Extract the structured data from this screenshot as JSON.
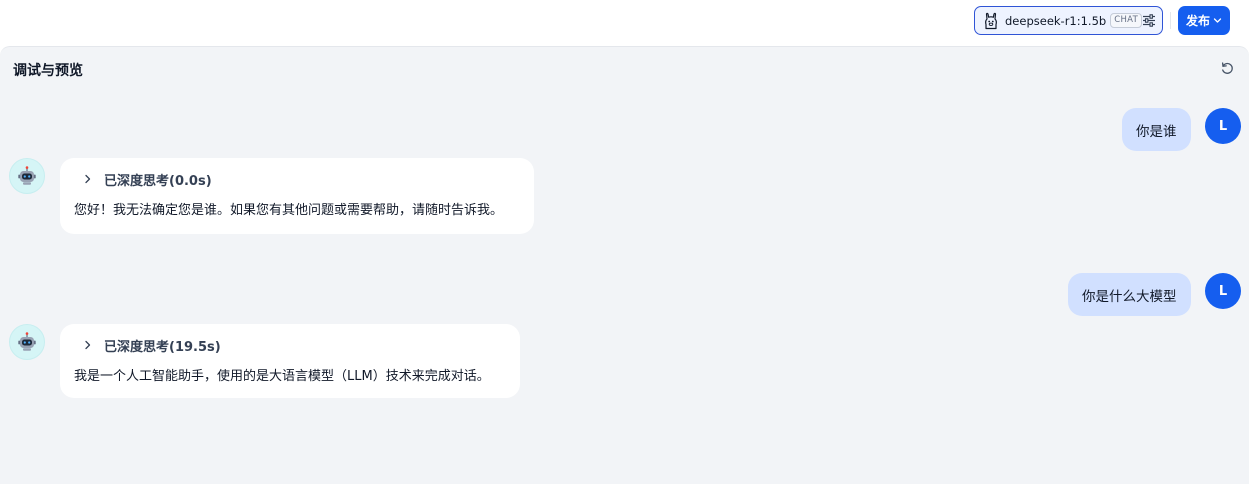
{
  "header": {
    "model": {
      "icon": "llama-icon",
      "name": "deepseek-r1:1.5b",
      "mode_badge": "CHAT",
      "settings_icon": "sliders-icon"
    },
    "publish_label": "发布",
    "publish_icon": "chevron-down-icon",
    "accent_color": "#155eef"
  },
  "panel": {
    "title": "调试与预览",
    "refresh_icon": "refresh-icon"
  },
  "conversation": [
    {
      "user": {
        "text": "你是谁",
        "avatar_initial": "L"
      },
      "assistant": {
        "avatar_icon": "robot-icon",
        "thinking_label": "已深度思考(0.0s)",
        "answer": "您好！我无法确定您是谁。如果您有其他问题或需要帮助，请随时告诉我。"
      }
    },
    {
      "user": {
        "text": "你是什么大模型",
        "avatar_initial": "L"
      },
      "assistant": {
        "avatar_icon": "robot-icon",
        "thinking_label": "已深度思考(19.5s)",
        "answer": "我是一个人工智能助手，使用的是大语言模型（LLM）技术来完成对话。"
      }
    }
  ]
}
